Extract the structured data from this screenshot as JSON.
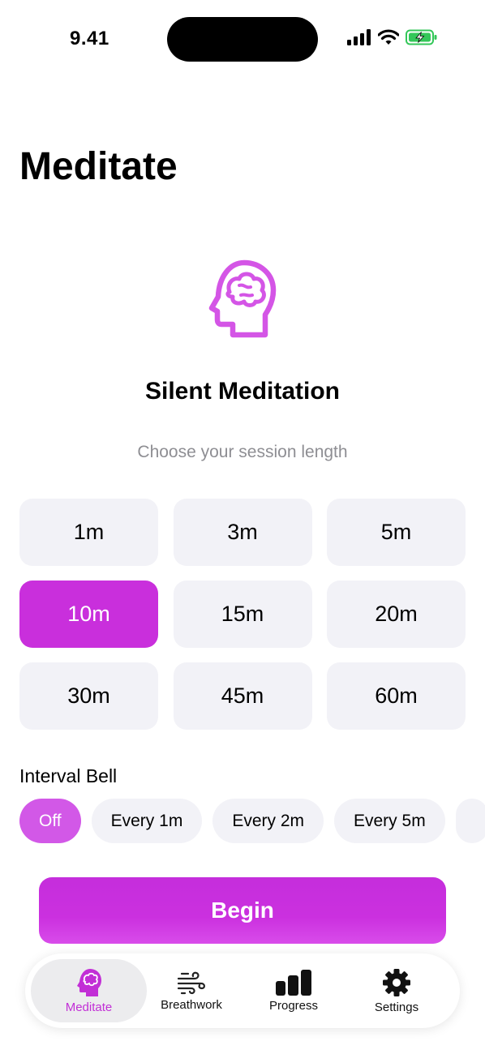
{
  "status_bar": {
    "time": "9.41"
  },
  "header": {
    "title": "Meditate"
  },
  "hero": {
    "icon": "brain-head-icon",
    "title": "Silent Meditation",
    "subtitle": "Choose your session length"
  },
  "durations": {
    "items": [
      {
        "label": "1m"
      },
      {
        "label": "3m"
      },
      {
        "label": "5m"
      },
      {
        "label": "10m",
        "selected": true
      },
      {
        "label": "15m"
      },
      {
        "label": "20m"
      },
      {
        "label": "30m"
      },
      {
        "label": "45m"
      },
      {
        "label": "60m"
      }
    ]
  },
  "interval_bell": {
    "label": "Interval Bell",
    "options": [
      {
        "label": "Off",
        "selected": true
      },
      {
        "label": "Every 1m"
      },
      {
        "label": "Every 2m"
      },
      {
        "label": "Every 5m"
      }
    ]
  },
  "begin_button": {
    "label": "Begin"
  },
  "tab_bar": {
    "tabs": [
      {
        "label": "Meditate",
        "icon": "brain-head-icon",
        "active": true
      },
      {
        "label": "Breathwork",
        "icon": "wind-icon"
      },
      {
        "label": "Progress",
        "icon": "bar-chart-icon"
      },
      {
        "label": "Settings",
        "icon": "gear-icon"
      }
    ]
  },
  "colors": {
    "accent": "#c92fdc",
    "accent_light": "#d258e7",
    "chip_bg": "#f2f2f7",
    "secondary_text": "#8e8e93",
    "battery_green": "#34c759"
  }
}
